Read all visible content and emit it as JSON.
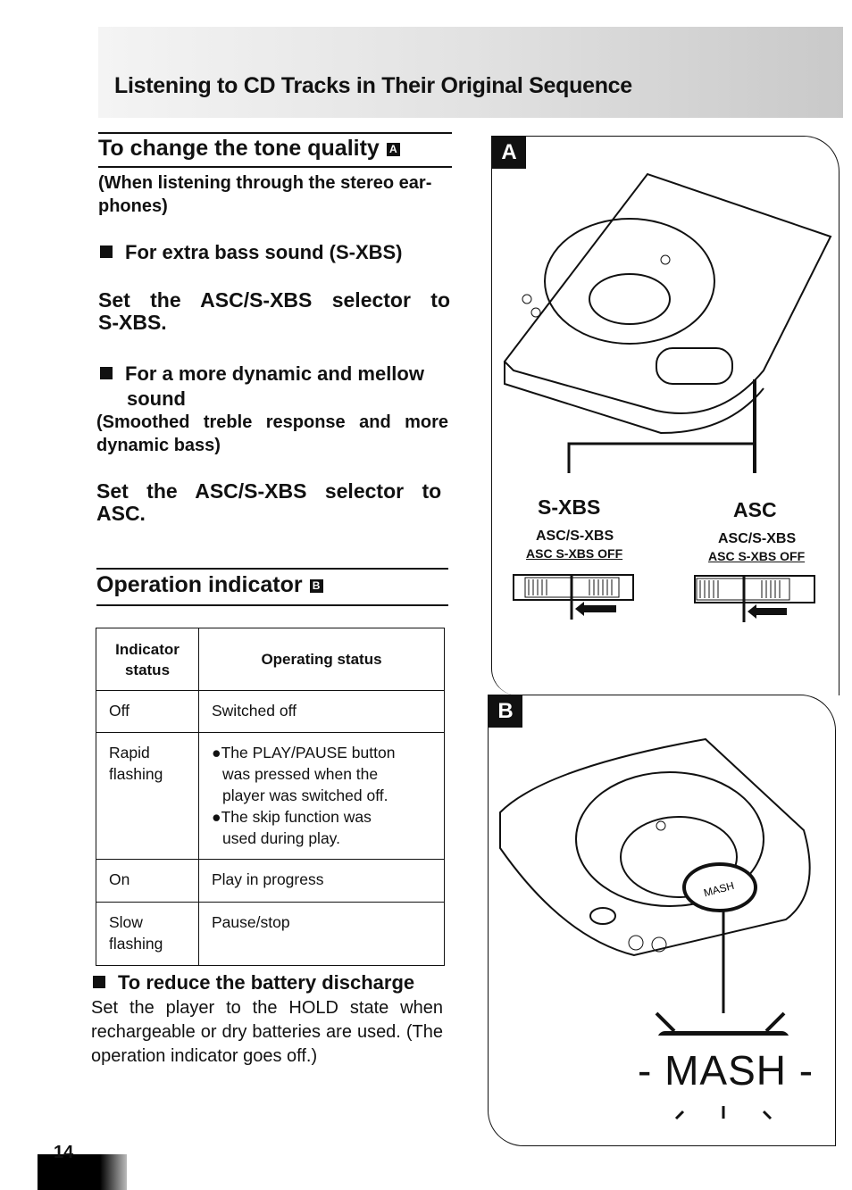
{
  "header": {
    "title": "Listening to CD Tracks in Their Original Sequence"
  },
  "tone": {
    "title": "To change the tone quality",
    "figure_ref": "A",
    "note": "(When listening through the stereo ear-phones)",
    "bass_heading": "For extra bass sound (S-XBS)",
    "bass_instruction": "Set the ASC/S-XBS selector to S-XBS.",
    "mellow_heading": "For a more dynamic and mellow sound",
    "mellow_note": "(Smoothed treble response and more dynamic bass)",
    "mellow_instruction": "Set the ASC/S-XBS selector to ASC."
  },
  "operation": {
    "title": "Operation indicator",
    "figure_ref": "B",
    "table": {
      "headers": [
        "Indicator status",
        "Operating status"
      ],
      "rows": [
        {
          "status": "Off",
          "desc": [
            "Switched off"
          ]
        },
        {
          "status": "Rapid flashing",
          "desc": [
            "●The PLAY/PAUSE button was pressed when the player was switched off.",
            "●The skip function was used during play."
          ]
        },
        {
          "status": "On",
          "desc": [
            "Play in progress"
          ]
        },
        {
          "status": "Slow flashing",
          "desc": [
            "Pause/stop"
          ]
        }
      ]
    }
  },
  "battery": {
    "heading": "To reduce the battery discharge",
    "text": "Set the player to the HOLD state when rechargeable or dry batteries are used. (The operation indicator goes off.)"
  },
  "figure_a": {
    "label": "A",
    "left": {
      "title": "S-XBS",
      "selector": "ASC/S-XBS",
      "positions": "ASC S-XBS OFF"
    },
    "right": {
      "title": "ASC",
      "selector": "ASC/S-XBS",
      "positions": "ASC S-XBS OFF"
    }
  },
  "figure_b": {
    "label": "B",
    "button_text": "MASH",
    "caption": "- MASH -"
  },
  "page_number": "14"
}
